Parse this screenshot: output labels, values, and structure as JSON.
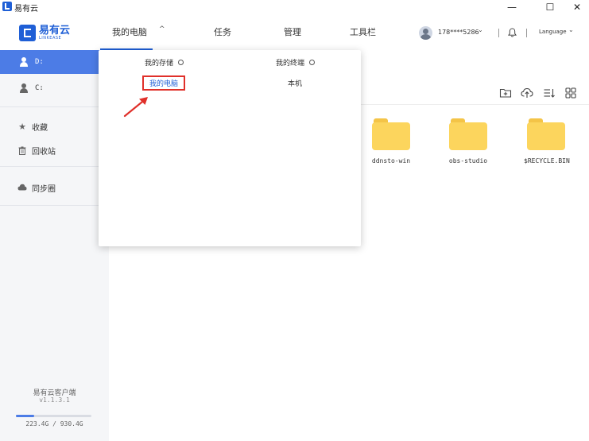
{
  "titlebar": {
    "app_name": "易有云",
    "minimize": "—",
    "maximize": "☐",
    "close": "✕"
  },
  "header": {
    "logo_zh": "易有云",
    "logo_en": "LINKEASE",
    "nav": [
      {
        "label": "我的电脑"
      },
      {
        "label": "任务"
      },
      {
        "label": "管理"
      },
      {
        "label": "工具栏"
      }
    ],
    "caret": "^",
    "user": "178****5286",
    "user_chevron": "⌄",
    "language": "Language",
    "language_chevron": "⌄",
    "accent": "#1f5fd6"
  },
  "sidebar": {
    "drives": [
      {
        "label": "D:",
        "active": true
      },
      {
        "label": "C:",
        "active": false
      }
    ],
    "items": [
      {
        "label": "收藏",
        "icon": "star-icon"
      },
      {
        "label": "回收站",
        "icon": "trash-icon"
      },
      {
        "label": "同步圈",
        "icon": "cloud-icon"
      }
    ],
    "client_name": "易有云客户端",
    "client_version": "v1.1.3.1",
    "storage_text": "223.4G / 930.4G",
    "storage_fraction": 0.24,
    "active_color": "#4c7ce6"
  },
  "main": {
    "tools": [
      "new-folder-icon",
      "upload-icon",
      "sort-icon",
      "grid-view-icon"
    ],
    "folders": [
      {
        "name": "ddnsto-win"
      },
      {
        "name": "obs-studio"
      },
      {
        "name": "$RECYCLE.BIN"
      }
    ],
    "folder_color": "#fcd55d"
  },
  "dropdown": {
    "col1_title": "我的存储",
    "col2_title": "我的终端",
    "selected_item": "我的电脑",
    "local_item": "本机",
    "highlight_color": "#e0302a"
  }
}
